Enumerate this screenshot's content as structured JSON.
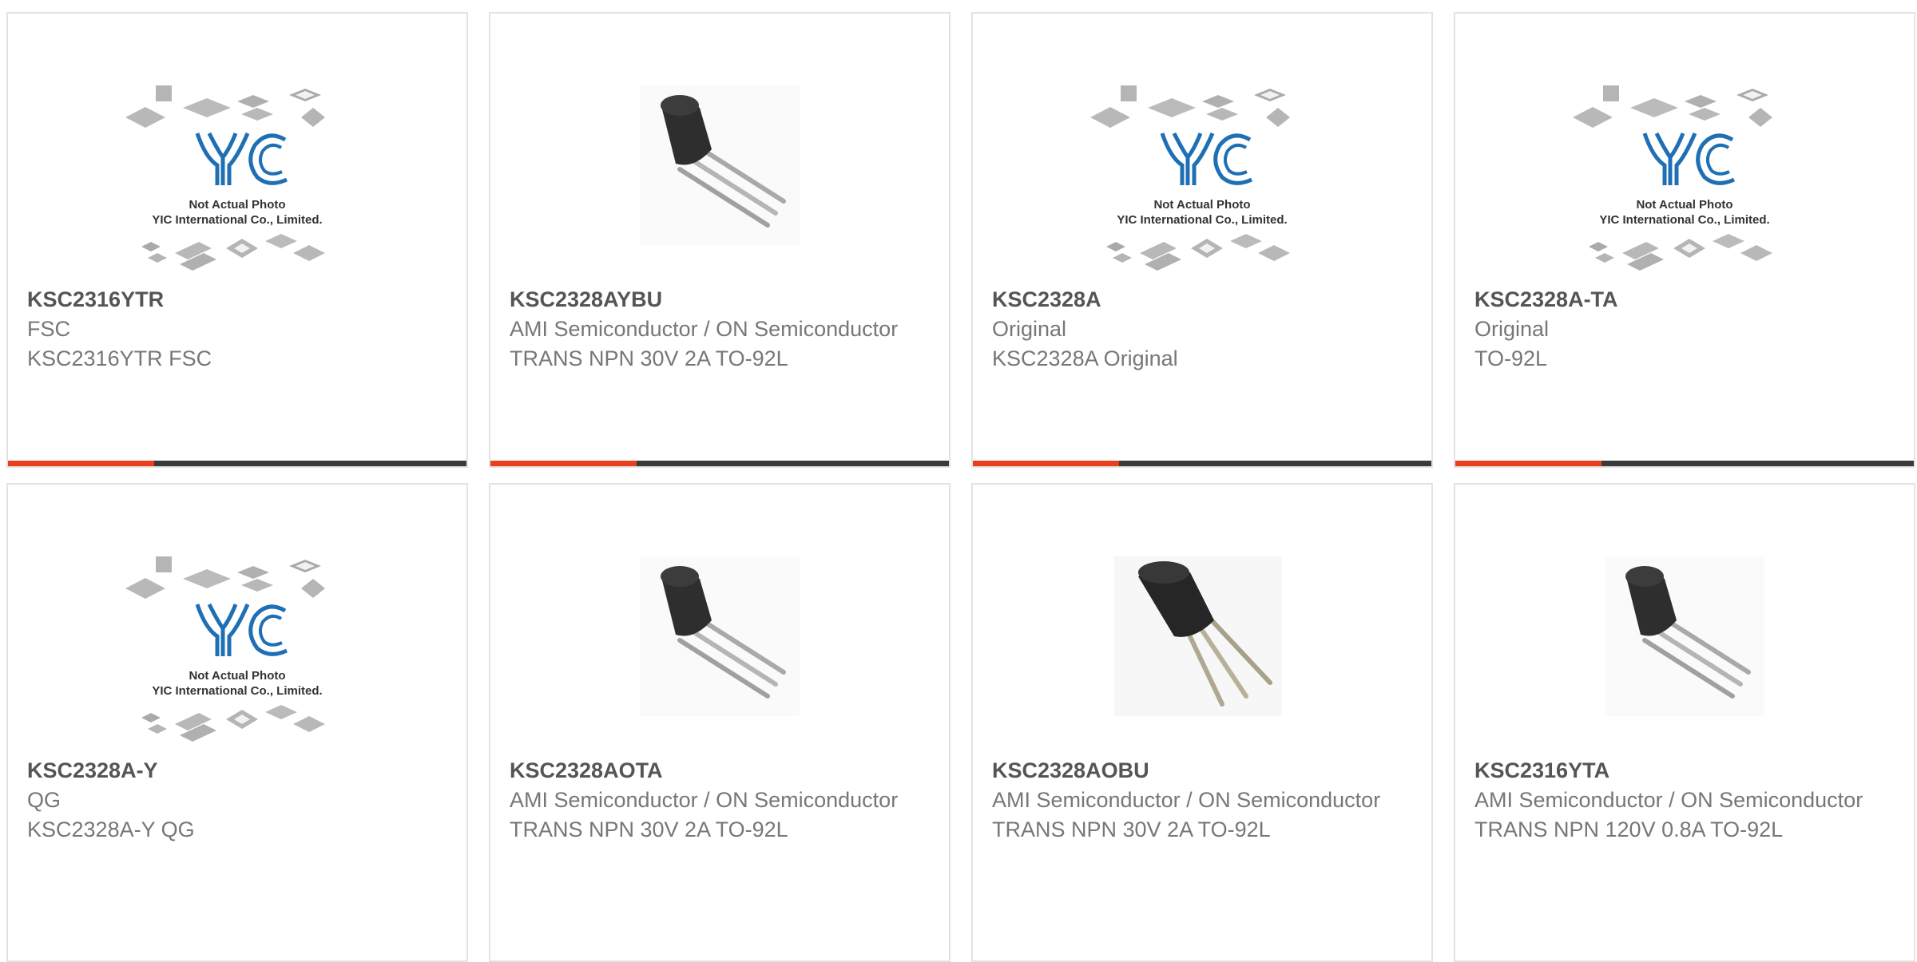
{
  "theme": {
    "accent": "#e8401c",
    "bar": "#3a3a3a",
    "name_color": "#555555",
    "text_color": "#777777"
  },
  "placeholder": {
    "line1": "Not Actual Photo",
    "line2": "YIC International Co., Limited."
  },
  "products": [
    {
      "name": "KSC2316YTR",
      "manufacturer": "FSC",
      "description": "KSC2316YTR FSC",
      "image": "yic-placeholder-icon"
    },
    {
      "name": "KSC2328AYBU",
      "manufacturer": "AMI Semiconductor / ON Semiconductor",
      "description": "TRANS NPN 30V 2A TO-92L",
      "image": "to92-transistor-icon"
    },
    {
      "name": "KSC2328A",
      "manufacturer": "Original",
      "description": "KSC2328A Original",
      "image": "yic-placeholder-icon"
    },
    {
      "name": "KSC2328A-TA",
      "manufacturer": "Original",
      "description": "TO-92L",
      "image": "yic-placeholder-icon"
    },
    {
      "name": "KSC2328A-Y",
      "manufacturer": "QG",
      "description": "KSC2328A-Y QG",
      "image": "yic-placeholder-icon"
    },
    {
      "name": "KSC2328AOTA",
      "manufacturer": "AMI Semiconductor / ON Semiconductor",
      "description": "TRANS NPN 30V 2A TO-92L",
      "image": "to92-transistor-icon"
    },
    {
      "name": "KSC2328AOBU",
      "manufacturer": "AMI Semiconductor / ON Semiconductor",
      "description": "TRANS NPN 30V 2A TO-92L",
      "image": "to92-transistor-icon"
    },
    {
      "name": "KSC2316YTA",
      "manufacturer": "AMI Semiconductor / ON Semiconductor",
      "description": "TRANS NPN 120V 0.8A TO-92L",
      "image": "to92-transistor-icon"
    }
  ]
}
